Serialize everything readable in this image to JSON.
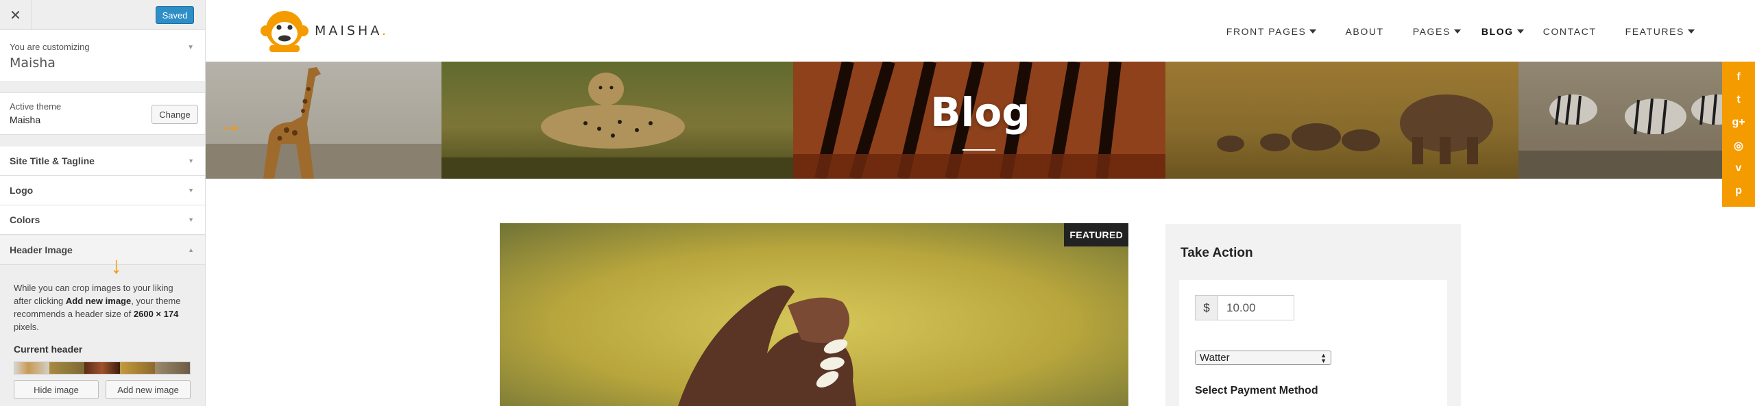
{
  "customizer": {
    "saved_label": "Saved",
    "customizing_label": "You are customizing",
    "site_name": "Maisha",
    "active_theme_label": "Active theme",
    "active_theme_name": "Maisha",
    "change_label": "Change",
    "sections": [
      {
        "label": "Site Title & Tagline"
      },
      {
        "label": "Logo"
      },
      {
        "label": "Colors"
      },
      {
        "label": "Header Image"
      }
    ],
    "header_image": {
      "desc_1": "While you can crop images to your liking after clicking ",
      "desc_bold_1": "Add new image",
      "desc_2": ", your theme recommends a header size of ",
      "desc_bold_2": "2600 × 174",
      "desc_3": " pixels.",
      "current_label": "Current header",
      "hide_label": "Hide image",
      "add_label": "Add new image"
    }
  },
  "site": {
    "logo_text": "MAISHA",
    "logo_dot": ".",
    "nav": [
      {
        "label": "FRONT PAGES",
        "dropdown": true
      },
      {
        "label": "ABOUT",
        "dropdown": false
      },
      {
        "label": "PAGES",
        "dropdown": true
      },
      {
        "label": "BLOG",
        "dropdown": true,
        "active": true
      },
      {
        "label": "CONTACT",
        "dropdown": false
      },
      {
        "label": "FEATURES",
        "dropdown": true
      }
    ],
    "banner_title": "Blog",
    "social_icons": [
      "facebook-icon",
      "twitter-icon",
      "google-plus-icon",
      "instagram-icon",
      "vimeo-icon",
      "pinterest-icon"
    ],
    "featured_label": "FEATURED",
    "widget": {
      "title": "Take Action",
      "currency_symbol": "$",
      "amount": "10.00",
      "selected_option": "Watter",
      "payment_label": "Select Payment Method"
    }
  },
  "colors": {
    "accent": "#f49b00",
    "saved_button": "#2e8ec6"
  }
}
